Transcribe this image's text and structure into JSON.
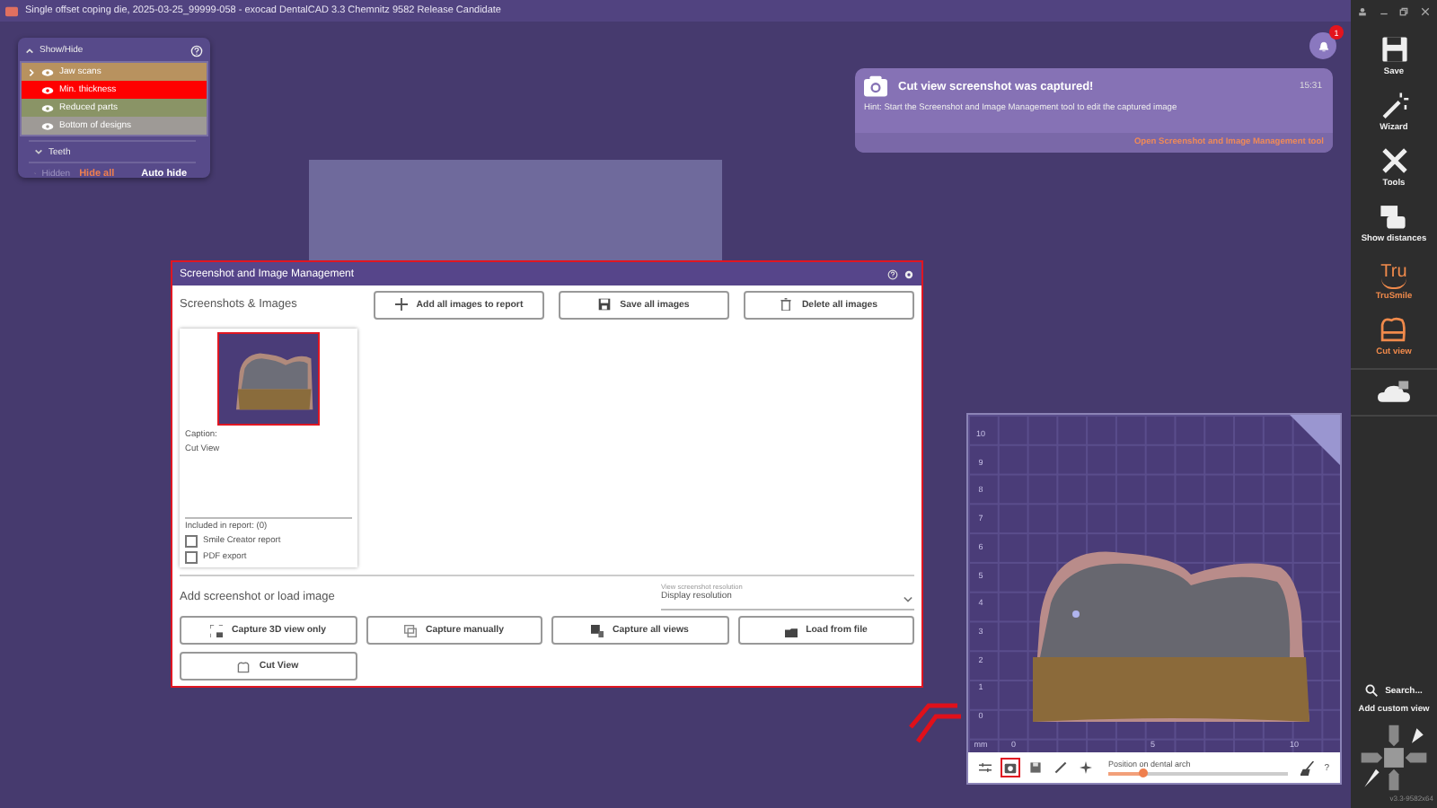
{
  "window": {
    "title": "Single offset coping die, 2025-03-25_99999-058 - exocad DentalCAD 3.3 Chemnitz 9582 Release Candidate"
  },
  "show_hide": {
    "title": "Show/Hide",
    "items": [
      {
        "label": "Jaw scans",
        "color": "#b8925f",
        "expandable": true
      },
      {
        "label": "Min. thickness",
        "color": "#ff0000",
        "expandable": false
      },
      {
        "label": "Reduced parts",
        "color": "#8a9466",
        "expandable": false
      },
      {
        "label": "Bottom of designs",
        "color": "#9e9a96",
        "expandable": false
      }
    ],
    "groups": [
      "Teeth",
      "Hidden"
    ],
    "hide_all": "Hide all",
    "auto_hide": "Auto hide"
  },
  "notification": {
    "badge": "1",
    "title": "Cut view screenshot was captured!",
    "time": "15:31",
    "hint": "Hint: Start the Screenshot and Image Management tool to edit the captured image",
    "link": "Open Screenshot and Image Management tool"
  },
  "dialog": {
    "title": "Screenshot and Image Management",
    "images_heading": "Screenshots & Images",
    "top_buttons": [
      {
        "kind": "add",
        "label": "Add all images to report"
      },
      {
        "kind": "save",
        "label": "Save all images"
      },
      {
        "kind": "delete",
        "label": "Delete all images"
      }
    ],
    "image": {
      "selected": true,
      "caption_label": "Caption:",
      "caption": "Cut View",
      "included_label": "Included in report: (0)",
      "options": [
        {
          "label": "Smile Creator report",
          "checked": false
        },
        {
          "label": "PDF export",
          "checked": false
        }
      ]
    },
    "add_heading": "Add screenshot or load image",
    "resolution_label": "View screenshot resolution",
    "resolution": "Display resolution",
    "capture_buttons": [
      {
        "kind": "capture3d",
        "label": "Capture 3D view only"
      },
      {
        "kind": "manual",
        "label": "Capture manually"
      },
      {
        "kind": "allviews",
        "label": "Capture all views"
      },
      {
        "kind": "load",
        "label": "Load from file"
      },
      {
        "kind": "cutview",
        "label": "Cut View"
      }
    ]
  },
  "cut_view": {
    "y_ticks": [
      "10",
      "9",
      "8",
      "7",
      "6",
      "5",
      "4",
      "3",
      "2",
      "1",
      "0"
    ],
    "unit": "mm",
    "x_ticks": [
      "0",
      "5",
      "10"
    ],
    "tools": [
      {
        "kind": "sliders",
        "highlighted": false
      },
      {
        "kind": "camera",
        "highlighted": true
      },
      {
        "kind": "save",
        "highlighted": false
      },
      {
        "kind": "pen",
        "highlighted": false
      },
      {
        "kind": "star",
        "highlighted": false
      }
    ],
    "slider_label": "Position on dental arch",
    "level": 0.19,
    "help": "?"
  },
  "sidebar": {
    "items": [
      {
        "kind": "save",
        "label": "Save",
        "active": false
      },
      {
        "kind": "wizard",
        "label": "Wizard",
        "active": false
      },
      {
        "kind": "tools",
        "label": "Tools",
        "active": false
      },
      {
        "kind": "distances",
        "label": "Show distances",
        "active": false
      },
      {
        "kind": "trusmile",
        "label": "TruSmile",
        "active": true,
        "glyph": "Tru"
      },
      {
        "kind": "cutview",
        "label": "Cut view",
        "active": true
      }
    ],
    "search": "Search...",
    "add_view": "Add custom view",
    "version": "v3.3-9582x64"
  }
}
